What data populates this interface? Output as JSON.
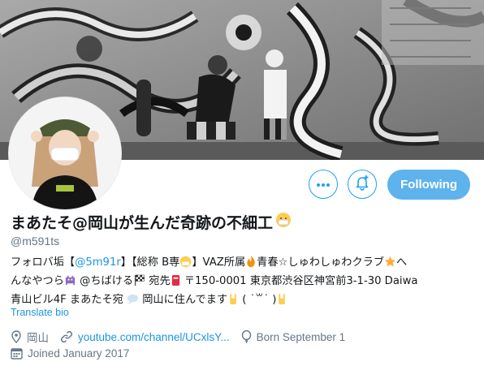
{
  "profile": {
    "display_name": "まあたそ@岡山が生んだ奇跡の不細工",
    "handle": "@m591ts",
    "bio": {
      "line1_a": "フォロバ垢【",
      "line1_mention": "@5m91r",
      "line1_b": "】【総称 B専",
      "line1_c": "】VAZ所属",
      "line1_d": "青春☆しゅわしゅわクラブ",
      "line1_e": "へ",
      "line2_a": "んなやつら",
      "line2_b": " @ちばける",
      "line2_c": " 宛先",
      "line2_d": " 〒150-0001 東京都渋谷区神宮前3-1-30 Daiwa",
      "line3_a": "青山ビル4F まあたそ宛 ",
      "line3_b": " 岡山に住んでます",
      "line3_c": " ( ˙꒳˙ )"
    },
    "translate_label": "Translate bio",
    "location": "岡山",
    "website": "youtube.com/channel/UCxlsY...",
    "birthday": "Born September 1",
    "joined": "Joined January 2017"
  },
  "actions": {
    "follow_label": "Following"
  },
  "colors": {
    "accent": "#1da1f2",
    "link": "#1b95e0",
    "follow_bg": "#5eb3ec",
    "muted": "#657786"
  },
  "icons": [
    "more-icon",
    "bell-plus-icon",
    "location-pin-icon",
    "link-icon",
    "balloon-icon",
    "calendar-icon"
  ]
}
